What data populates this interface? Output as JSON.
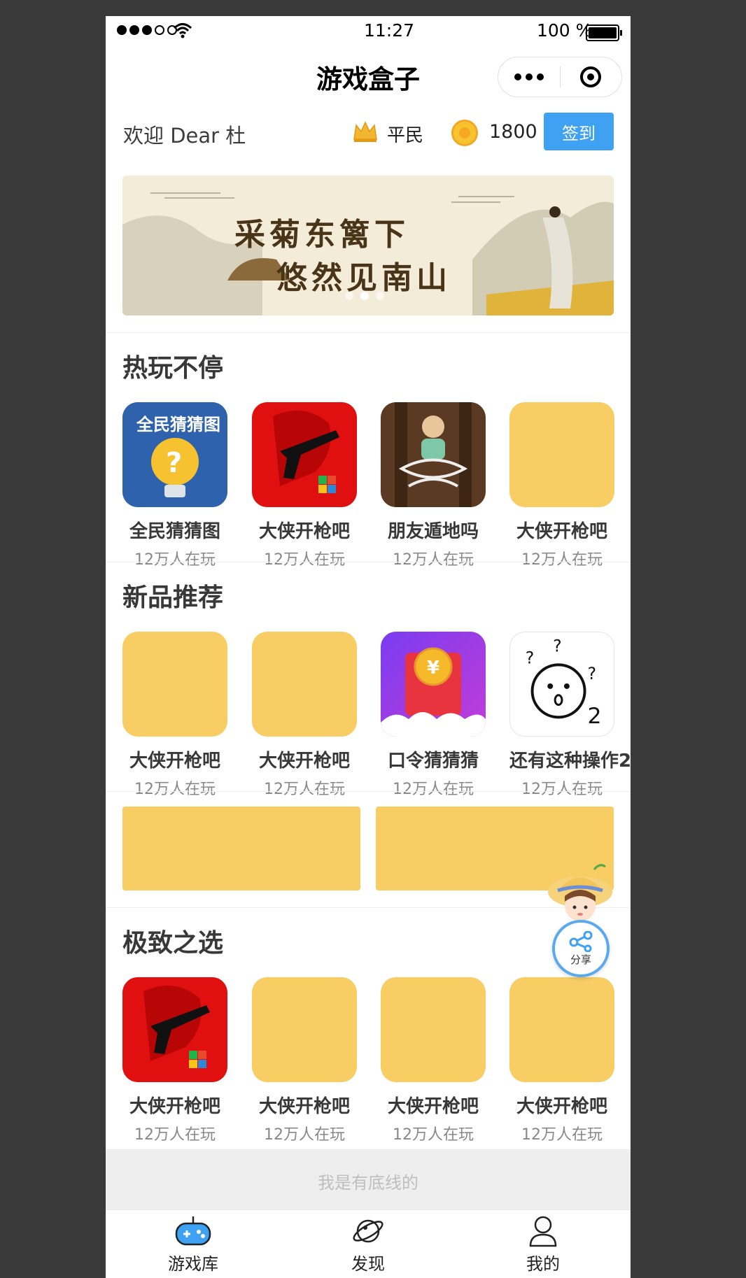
{
  "status_bar": {
    "time": "11:27",
    "battery": "100 %"
  },
  "navbar": {
    "title": "游戏盒子"
  },
  "user": {
    "welcome": "欢迎 Dear 杜",
    "rank": "平民",
    "coins": "1800",
    "signin_label": "签到"
  },
  "banner": {
    "line1": "采菊东篱下",
    "line2": "悠然见南山",
    "page_count": 3,
    "active_index": 1
  },
  "sections": {
    "hot": {
      "title": "热玩不停",
      "games": [
        {
          "name": "全民猜猜图",
          "players": "12万人在玩"
        },
        {
          "name": "大侠开枪吧",
          "players": "12万人在玩"
        },
        {
          "name": "朋友遁地吗",
          "players": "12万人在玩"
        },
        {
          "name": "大侠开枪吧",
          "players": "12万人在玩"
        }
      ]
    },
    "new": {
      "title": "新品推荐",
      "games": [
        {
          "name": "大侠开枪吧",
          "players": "12万人在玩"
        },
        {
          "name": "大侠开枪吧",
          "players": "12万人在玩"
        },
        {
          "name": "口令猜猜猜",
          "players": "12万人在玩"
        },
        {
          "name": "还有这种操作2",
          "players": "12万人在玩"
        }
      ]
    },
    "best": {
      "title": "极致之选",
      "games": [
        {
          "name": "大侠开枪吧",
          "players": "12万人在玩"
        },
        {
          "name": "大侠开枪吧",
          "players": "12万人在玩"
        },
        {
          "name": "大侠开枪吧",
          "players": "12万人在玩"
        },
        {
          "name": "大侠开枪吧",
          "players": "12万人在玩"
        }
      ]
    }
  },
  "share": {
    "label": "分享"
  },
  "footer": {
    "text": "我是有底线的"
  },
  "tabs": [
    {
      "label": "游戏库",
      "icon": "gamepad-icon",
      "active": true
    },
    {
      "label": "发现",
      "icon": "planet-icon",
      "active": false
    },
    {
      "label": "我的",
      "icon": "user-icon",
      "active": false
    }
  ],
  "colors": {
    "accent": "#3ea1f2",
    "placeholder": "#f7cd64",
    "title_text": "#383838",
    "sub_text": "#888888",
    "footer_bg": "#eeeeee",
    "footer_text": "#bebebe"
  }
}
